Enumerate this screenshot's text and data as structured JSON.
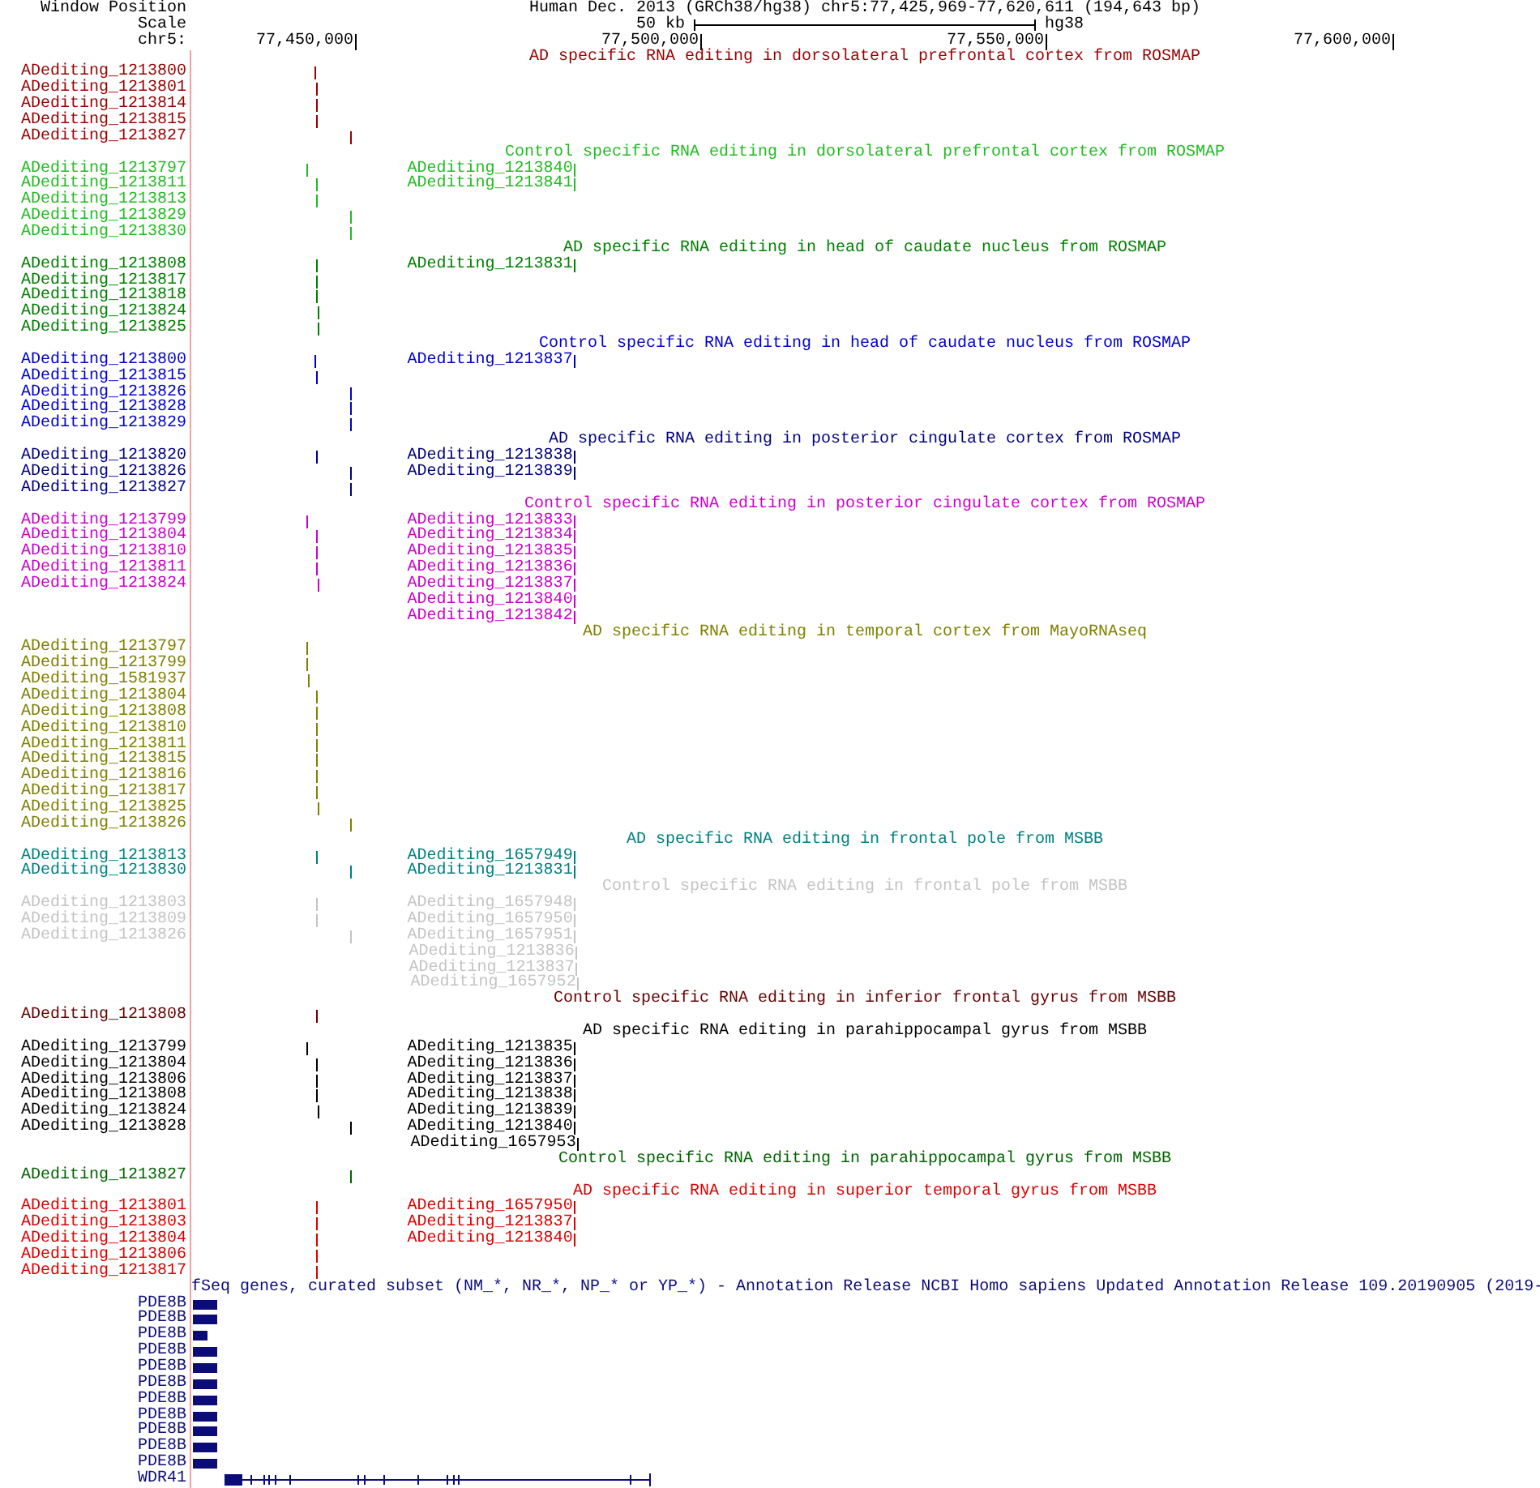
{
  "header": {
    "window_position_label": "Window Position",
    "assembly": "Human Dec. 2013 (GRCh38/hg38)",
    "position": "chr5:77,425,969-77,620,611 (194,643 bp)"
  },
  "scale": {
    "label": "Scale",
    "bar_label": "50 kb",
    "assembly_short": "hg38"
  },
  "ruler": {
    "label": "chr5:",
    "positions": [
      {
        "label": "77,450,000",
        "level": 0.1237
      },
      {
        "label": "77,500,000",
        "level": 0.3794
      },
      {
        "label": "77,550,000",
        "level": 0.6351
      },
      {
        "label": "77,600,000",
        "level": 0.892
      }
    ]
  },
  "tracks": [
    {
      "title": "AD specific RNA editing in dorsolateral prefrontal cortex from ROSMAP",
      "color": "#990000",
      "rows": [
        {
          "label": "ADediting_1213800",
          "level": 0.0927
        },
        {
          "label": "ADediting_1213801",
          "level": 0.0939
        },
        {
          "label": "ADediting_1213814",
          "level": 0.0939
        },
        {
          "label": "ADediting_1213815",
          "level": 0.0939
        },
        {
          "label": "ADediting_1213827",
          "level": 0.1185
        }
      ]
    },
    {
      "title": "Control specific RNA editing in dorsolateral prefrontal cortex from ROSMAP",
      "color": "#22bb22",
      "rows": [
        {
          "label": "ADediting_1213797",
          "level": 0.0867,
          "features": [
            {
              "label": "ADediting_1213840",
              "level": 0.2849
            }
          ]
        },
        {
          "label": "ADediting_1213811",
          "level": 0.0939,
          "features": [
            {
              "label": "ADediting_1213841",
              "level": 0.2849
            }
          ]
        },
        {
          "label": "ADediting_1213813",
          "level": 0.0939
        },
        {
          "label": "ADediting_1213829",
          "level": 0.1185
        },
        {
          "label": "ADediting_1213830",
          "level": 0.1185
        }
      ]
    },
    {
      "title": "AD specific RNA editing in head of caudate nucleus from ROSMAP",
      "color": "#008000",
      "rows": [
        {
          "label": "ADediting_1213808",
          "level": 0.0939,
          "features": [
            {
              "label": "ADediting_1213831",
              "level": 0.2849
            }
          ]
        },
        {
          "label": "ADediting_1213817",
          "level": 0.0939
        },
        {
          "label": "ADediting_1213818",
          "level": 0.0939
        },
        {
          "label": "ADediting_1213824",
          "level": 0.0951
        },
        {
          "label": "ADediting_1213825",
          "level": 0.0951
        }
      ]
    },
    {
      "title": "Control specific RNA editing in head of caudate nucleus from ROSMAP",
      "color": "#0000cc",
      "rows": [
        {
          "label": "ADediting_1213800",
          "level": 0.0927,
          "features": [
            {
              "label": "ADediting_1213837",
              "level": 0.2849
            }
          ]
        },
        {
          "label": "ADediting_1213815",
          "level": 0.0939
        },
        {
          "label": "ADediting_1213826",
          "level": 0.1185
        },
        {
          "label": "ADediting_1213828",
          "level": 0.1185
        },
        {
          "label": "ADediting_1213829",
          "level": 0.1185
        }
      ]
    },
    {
      "title": "AD specific RNA editing in posterior cingulate cortex from ROSMAP",
      "color": "#000080",
      "rows": [
        {
          "label": "ADediting_1213820",
          "level": 0.0939,
          "features": [
            {
              "label": "ADediting_1213838",
              "level": 0.2849
            }
          ]
        },
        {
          "label": "ADediting_1213826",
          "level": 0.1185,
          "features": [
            {
              "label": "ADediting_1213839",
              "level": 0.2849
            }
          ]
        },
        {
          "label": "ADediting_1213827",
          "level": 0.1185
        }
      ]
    },
    {
      "title": "Control specific RNA editing in posterior cingulate cortex from ROSMAP",
      "color": "#cc00cc",
      "rows": [
        {
          "label": "ADediting_1213799",
          "level": 0.0867,
          "features": [
            {
              "label": "ADediting_1213833",
              "level": 0.2849
            }
          ]
        },
        {
          "label": "ADediting_1213804",
          "level": 0.0939,
          "features": [
            {
              "label": "ADediting_1213834",
              "level": 0.2849
            }
          ]
        },
        {
          "label": "ADediting_1213810",
          "level": 0.0939,
          "features": [
            {
              "label": "ADediting_1213835",
              "level": 0.2849
            }
          ]
        },
        {
          "label": "ADediting_1213811",
          "level": 0.0939,
          "features": [
            {
              "label": "ADediting_1213836",
              "level": 0.2849
            }
          ]
        },
        {
          "label": "ADediting_1213824",
          "level": 0.0951,
          "features": [
            {
              "label": "ADediting_1213837",
              "level": 0.2849
            }
          ]
        },
        {
          "features": [
            {
              "label": "ADediting_1213840",
              "level": 0.2849
            }
          ]
        },
        {
          "features": [
            {
              "label": "ADediting_1213842",
              "level": 0.2849
            }
          ]
        }
      ]
    },
    {
      "title": "AD specific RNA editing in temporal cortex from MayoRNAseq",
      "color": "#808000",
      "rows": [
        {
          "label": "ADediting_1213797",
          "level": 0.0867
        },
        {
          "label": "ADediting_1213799",
          "level": 0.0867
        },
        {
          "label": "ADediting_1581937",
          "level": 0.0879
        },
        {
          "label": "ADediting_1213804",
          "level": 0.0939
        },
        {
          "label": "ADediting_1213808",
          "level": 0.0939
        },
        {
          "label": "ADediting_1213810",
          "level": 0.0939
        },
        {
          "label": "ADediting_1213811",
          "level": 0.0939
        },
        {
          "label": "ADediting_1213815",
          "level": 0.0939
        },
        {
          "label": "ADediting_1213816",
          "level": 0.0939
        },
        {
          "label": "ADediting_1213817",
          "level": 0.0939
        },
        {
          "label": "ADediting_1213825",
          "level": 0.0951
        },
        {
          "label": "ADediting_1213826",
          "level": 0.1185
        }
      ]
    },
    {
      "title": "AD specific RNA editing in frontal pole from MSBB",
      "color": "#008080",
      "rows": [
        {
          "label": "ADediting_1213813",
          "level": 0.0939,
          "features": [
            {
              "label": "ADediting_1657949",
              "level": 0.2849
            }
          ]
        },
        {
          "label": "ADediting_1213830",
          "level": 0.1185,
          "features": [
            {
              "label": "ADediting_1213831",
              "level": 0.2849
            }
          ]
        }
      ]
    },
    {
      "title": "Control specific RNA editing in frontal pole from MSBB",
      "color": "#c4c4c4",
      "rows": [
        {
          "label": "ADediting_1213803",
          "level": 0.0939,
          "features": [
            {
              "label": "ADediting_1657948",
              "level": 0.2849
            }
          ]
        },
        {
          "label": "ADediting_1213809",
          "level": 0.0939,
          "features": [
            {
              "label": "ADediting_1657950",
              "level": 0.2849
            }
          ]
        },
        {
          "label": "ADediting_1213826",
          "level": 0.1185,
          "features": [
            {
              "label": "ADediting_1657951",
              "level": 0.2849
            }
          ]
        },
        {
          "features": [
            {
              "label": "ADediting_1213836",
              "level": 0.2861
            }
          ]
        },
        {
          "features": [
            {
              "label": "ADediting_1213837",
              "level": 0.2861
            }
          ]
        },
        {
          "features": [
            {
              "label": "ADediting_1657952",
              "level": 0.2873
            }
          ]
        }
      ]
    },
    {
      "title": "Control specific RNA editing in inferior frontal gyrus from MSBB",
      "color": "#660000",
      "rows": [
        {
          "label": "ADediting_1213808",
          "level": 0.0939
        }
      ]
    },
    {
      "title": "AD specific RNA editing in parahippocampal gyrus from MSBB",
      "color": "#000000",
      "rows": [
        {
          "label": "ADediting_1213799",
          "level": 0.0867,
          "features": [
            {
              "label": "ADediting_1213835",
              "level": 0.2849
            }
          ]
        },
        {
          "label": "ADediting_1213804",
          "level": 0.0939,
          "features": [
            {
              "label": "ADediting_1213836",
              "level": 0.2849
            }
          ]
        },
        {
          "label": "ADediting_1213806",
          "level": 0.0939,
          "features": [
            {
              "label": "ADediting_1213837",
              "level": 0.2849
            }
          ]
        },
        {
          "label": "ADediting_1213808",
          "level": 0.0939,
          "features": [
            {
              "label": "ADediting_1213838",
              "level": 0.2849
            }
          ]
        },
        {
          "label": "ADediting_1213824",
          "level": 0.0951,
          "features": [
            {
              "label": "ADediting_1213839",
              "level": 0.2849
            }
          ]
        },
        {
          "label": "ADediting_1213828",
          "level": 0.1185,
          "features": [
            {
              "label": "ADediting_1213840",
              "level": 0.2849
            }
          ]
        },
        {
          "features": [
            {
              "label": "ADediting_1657953",
              "level": 0.2873
            }
          ]
        }
      ]
    },
    {
      "title": "Control specific RNA editing in parahippocampal gyrus from MSBB",
      "color": "#006400",
      "rows": [
        {
          "label": "ADediting_1213827",
          "level": 0.1185
        }
      ]
    },
    {
      "title": "AD specific RNA editing in superior temporal gyrus from MSBB",
      "color": "#dd0000",
      "rows": [
        {
          "label": "ADediting_1213801",
          "level": 0.0939,
          "features": [
            {
              "label": "ADediting_1657950",
              "level": 0.2849
            }
          ]
        },
        {
          "label": "ADediting_1213803",
          "level": 0.0939,
          "features": [
            {
              "label": "ADediting_1213837",
              "level": 0.2849
            }
          ]
        },
        {
          "label": "ADediting_1213804",
          "level": 0.0939,
          "features": [
            {
              "label": "ADediting_1213840",
              "level": 0.2849
            }
          ]
        },
        {
          "label": "ADediting_1213806",
          "level": 0.0939
        },
        {
          "label": "ADediting_1213817",
          "level": 0.0939
        }
      ]
    }
  ],
  "gene_track": {
    "title": "fSeq genes, curated subset (NM_*, NR_*, NP_* or YP_*) - Annotation Release NCBI Homo sapiens Updated Annotation Release 109.20190905 (2019-",
    "genes": [
      {
        "label": "PDE8B",
        "kind": "block",
        "level": 0.0204
      },
      {
        "label": "PDE8B",
        "kind": "block",
        "level": 0.0204
      },
      {
        "label": "PDE8B",
        "kind": "block",
        "level": 0.0132
      },
      {
        "label": "PDE8B",
        "kind": "block",
        "level": 0.0204
      },
      {
        "label": "PDE8B",
        "kind": "block",
        "level": 0.0204
      },
      {
        "label": "PDE8B",
        "kind": "block",
        "level": 0.0204
      },
      {
        "label": "PDE8B",
        "kind": "block",
        "level": 0.0204
      },
      {
        "label": "PDE8B",
        "kind": "block",
        "level": 0.0204
      },
      {
        "label": "PDE8B",
        "kind": "block",
        "level": 0.0204
      },
      {
        "label": "PDE8B",
        "kind": "block",
        "level": 0.0204
      },
      {
        "label": "PDE8B",
        "kind": "block",
        "level": 0.0204
      },
      {
        "label": "WDR41",
        "kind": "model",
        "level": 0.3421
      }
    ]
  }
}
